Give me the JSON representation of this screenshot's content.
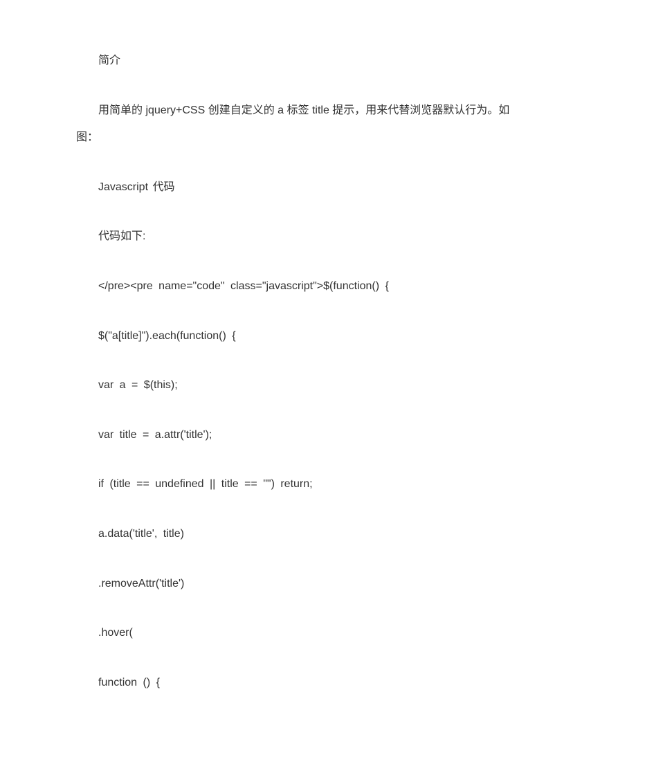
{
  "paragraphs": {
    "intro_heading": "简介",
    "description_line1": "用简单的 jquery+CSS 创建自定义的 a 标签 title 提示，用来代替浏览器默认行为。如",
    "description_line2": "图：",
    "js_heading": "Javascript 代码",
    "code_intro": "代码如下:"
  },
  "code_lines": [
    "</pre><pre name=\"code\" class=\"javascript\">$(function() {",
    "$(\"a[title]\").each(function() {",
    "var a = $(this);",
    "var title = a.attr('title');",
    "if (title == undefined || title == \"\") return;",
    "a.data('title', title)",
    ".removeAttr('title')",
    ".hover(",
    "function () {"
  ]
}
